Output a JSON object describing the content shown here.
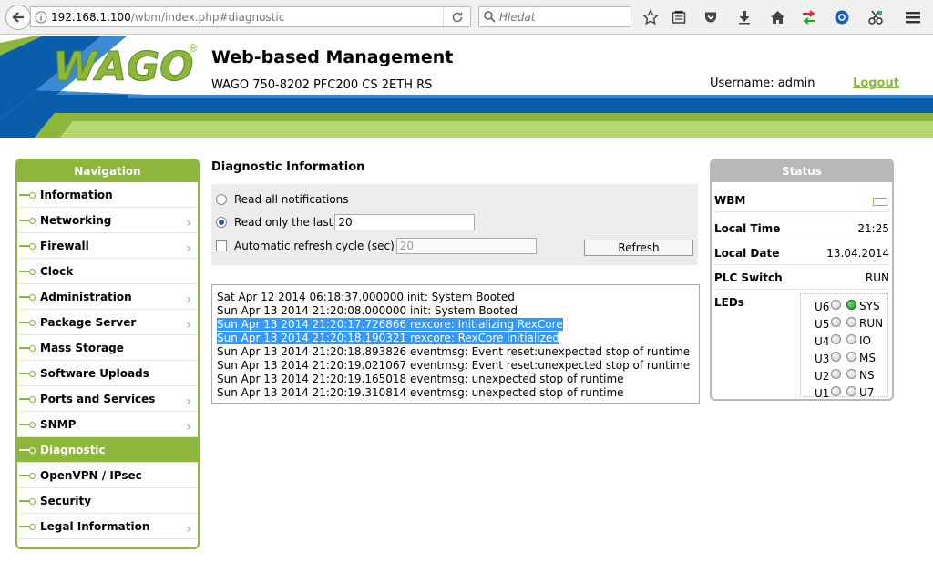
{
  "browser": {
    "url_host": "192.168.1.100",
    "url_path": "/wbm/index.php#diagnostic",
    "search_placeholder": "Hledat"
  },
  "header": {
    "title": "Web-based Management",
    "device": "WAGO 750-8202 PFC200 CS 2ETH RS",
    "username_label": "Username: admin",
    "logout": "Logout",
    "logo_text": "WAGO"
  },
  "nav": {
    "title": "Navigation",
    "items": [
      {
        "label": "Information",
        "has_sub": false
      },
      {
        "label": "Networking",
        "has_sub": true
      },
      {
        "label": "Firewall",
        "has_sub": true
      },
      {
        "label": "Clock",
        "has_sub": false
      },
      {
        "label": "Administration",
        "has_sub": true
      },
      {
        "label": "Package Server",
        "has_sub": true
      },
      {
        "label": "Mass Storage",
        "has_sub": false
      },
      {
        "label": "Software Uploads",
        "has_sub": false
      },
      {
        "label": "Ports and Services",
        "has_sub": true
      },
      {
        "label": "SNMP",
        "has_sub": true
      },
      {
        "label": "Diagnostic",
        "has_sub": false
      },
      {
        "label": "OpenVPN / IPsec",
        "has_sub": false
      },
      {
        "label": "Security",
        "has_sub": false
      },
      {
        "label": "Legal Information",
        "has_sub": true
      }
    ],
    "active": "Diagnostic"
  },
  "main": {
    "title": "Diagnostic Information",
    "opt_all": "Read all notifications",
    "opt_last": "Read only the last",
    "last_value": "20",
    "auto_label": "Automatic refresh cycle (sec)",
    "auto_value": "20",
    "refresh": "Refresh",
    "log": [
      {
        "text": "Sat Apr 12 2014 06:18:37.000000 init: System Booted",
        "selected": false
      },
      {
        "text": "Sun Apr 13 2014 21:20:08.000000 init: System Booted",
        "selected": false
      },
      {
        "text": "Sun Apr 13 2014 21:20:17.726866 rexcore: Initializing RexCore",
        "selected": true
      },
      {
        "text": "Sun Apr 13 2014 21:20:18.190321 rexcore: RexCore initialized",
        "selected": true
      },
      {
        "text": "Sun Apr 13 2014 21:20:18.893826 eventmsg: Event reset:unexpected stop of runtime",
        "selected": false
      },
      {
        "text": "Sun Apr 13 2014 21:20:19.021067 eventmsg: Event reset:unexpected stop of runtime",
        "selected": false
      },
      {
        "text": "Sun Apr 13 2014 21:20:19.165018 eventmsg: unexpected stop of runtime",
        "selected": false
      },
      {
        "text": "Sun Apr 13 2014 21:20:19.310814 eventmsg: unexpected stop of runtime",
        "selected": false
      }
    ]
  },
  "status": {
    "title": "Status",
    "wbm": "WBM",
    "local_time_label": "Local Time",
    "local_time": "21:25",
    "local_date_label": "Local Date",
    "local_date": "13.04.2014",
    "plc_switch_label": "PLC Switch",
    "plc_switch": "RUN",
    "leds_label": "LEDs",
    "leds": [
      {
        "left": "U6",
        "left_on": false,
        "right": "SYS",
        "right_on": true
      },
      {
        "left": "U5",
        "left_on": false,
        "right": "RUN",
        "right_on": false
      },
      {
        "left": "U4",
        "left_on": false,
        "right": "IO",
        "right_on": false
      },
      {
        "left": "U3",
        "left_on": false,
        "right": "MS",
        "right_on": false
      },
      {
        "left": "U2",
        "left_on": false,
        "right": "NS",
        "right_on": false
      },
      {
        "left": "U1",
        "left_on": false,
        "right": "U7",
        "right_on": false
      }
    ]
  },
  "colors": {
    "wago_green": "#8cb63c",
    "wago_blue": "#0a5dab",
    "selection": "#3399ff"
  }
}
